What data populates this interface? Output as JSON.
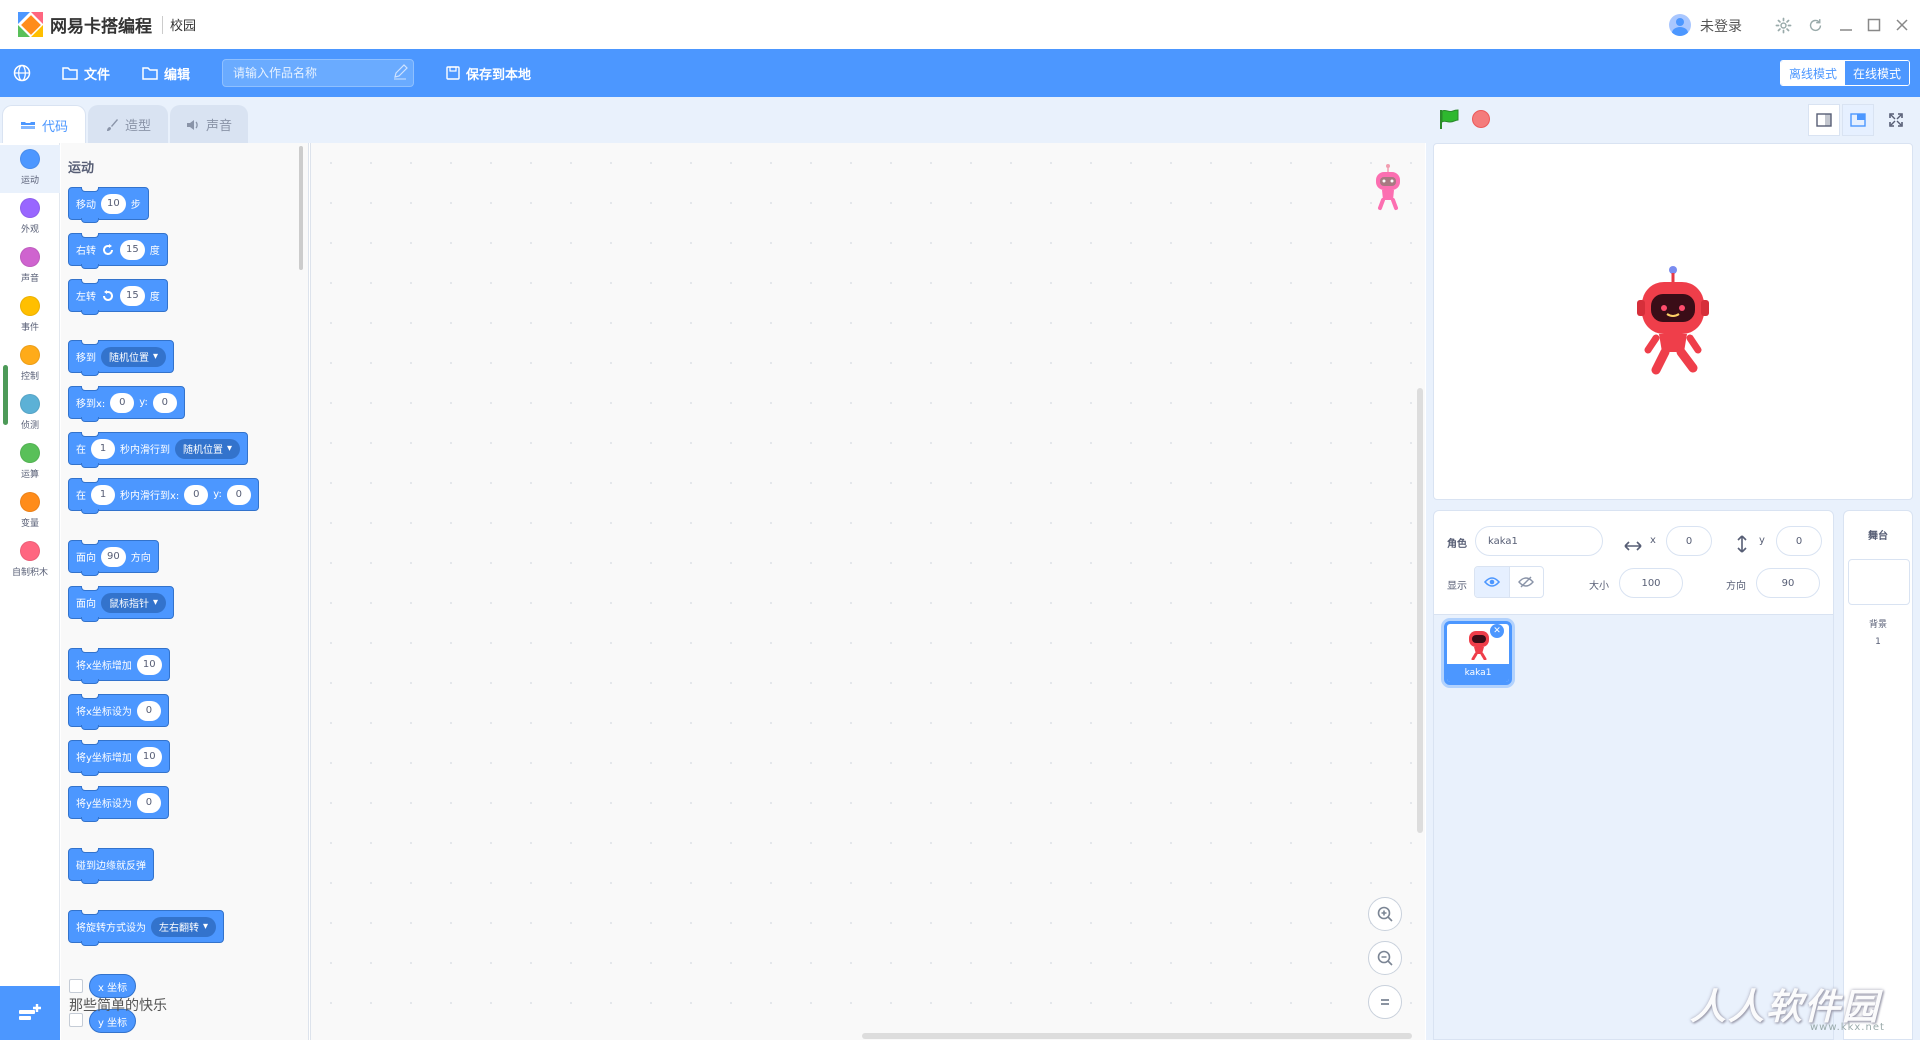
{
  "app": {
    "name": "网易卡搭编程",
    "edition": "校园",
    "login": "未登录"
  },
  "menubar": {
    "file": "文件",
    "edit": "编辑",
    "title_placeholder": "请输入作品名称",
    "save_local": "保存到本地",
    "offline_mode": "离线模式",
    "online_mode": "在线模式"
  },
  "tabs": [
    {
      "label": "代码",
      "active": true
    },
    {
      "label": "造型",
      "active": false
    },
    {
      "label": "声音",
      "active": false
    }
  ],
  "categories": [
    {
      "label": "运动",
      "color": "#4c97ff"
    },
    {
      "label": "外观",
      "color": "#9966ff"
    },
    {
      "label": "声音",
      "color": "#cf63cf"
    },
    {
      "label": "事件",
      "color": "#ffbf00"
    },
    {
      "label": "控制",
      "color": "#ffab19"
    },
    {
      "label": "侦测",
      "color": "#5cb1d6"
    },
    {
      "label": "运算",
      "color": "#59c059"
    },
    {
      "label": "变量",
      "color": "#ff8c1a"
    },
    {
      "label": "自制积木",
      "color": "#ff6680"
    }
  ],
  "palette": {
    "section_title": "运动",
    "blocks": {
      "move": {
        "a": "移动",
        "v": "10",
        "b": "步"
      },
      "turn_right": {
        "a": "右转",
        "v": "15",
        "b": "度"
      },
      "turn_left": {
        "a": "左转",
        "v": "15",
        "b": "度"
      },
      "goto": {
        "a": "移到",
        "dd": "随机位置"
      },
      "goto_xy": {
        "a": "移到x:",
        "x": "0",
        "b": "y:",
        "y": "0"
      },
      "glide_to": {
        "a": "在",
        "v": "1",
        "b": "秒内滑行到",
        "dd": "随机位置"
      },
      "glide_xy": {
        "a": "在",
        "v": "1",
        "b": "秒内滑行到x:",
        "x": "0",
        "c": "y:",
        "y": "0"
      },
      "point_dir": {
        "a": "面向",
        "v": "90",
        "b": "方向"
      },
      "point_toward": {
        "a": "面向",
        "dd": "鼠标指针"
      },
      "change_x": {
        "a": "将x坐标增加",
        "v": "10"
      },
      "set_x": {
        "a": "将x坐标设为",
        "v": "0"
      },
      "change_y": {
        "a": "将y坐标增加",
        "v": "10"
      },
      "set_y": {
        "a": "将y坐标设为",
        "v": "0"
      },
      "bounce": {
        "a": "碰到边缘就反弹"
      },
      "rotation_style": {
        "a": "将旋转方式设为",
        "dd": "左右翻转"
      },
      "x_pos": "x 坐标",
      "y_pos": "y 坐标"
    },
    "overlay_text": "那些简单的快乐"
  },
  "sprite_info": {
    "sprite_label": "角色",
    "sprite_name": "kaka1",
    "x_label": "x",
    "x": "0",
    "y_label": "y",
    "y": "0",
    "show_label": "显示",
    "size_label": "大小",
    "size": "100",
    "direction_label": "方向",
    "direction": "90"
  },
  "sprites": [
    {
      "name": "kaka1",
      "selected": true
    }
  ],
  "backdrop": {
    "title": "舞台",
    "label": "背景",
    "count": "1"
  },
  "watermark": {
    "text": "人人软件园",
    "sub": "www.kkx.net"
  },
  "colors": {
    "accent": "#4c97ff",
    "motion": "#4c97ff",
    "stop": "#f47c7c",
    "flag": "#2eb82e"
  }
}
